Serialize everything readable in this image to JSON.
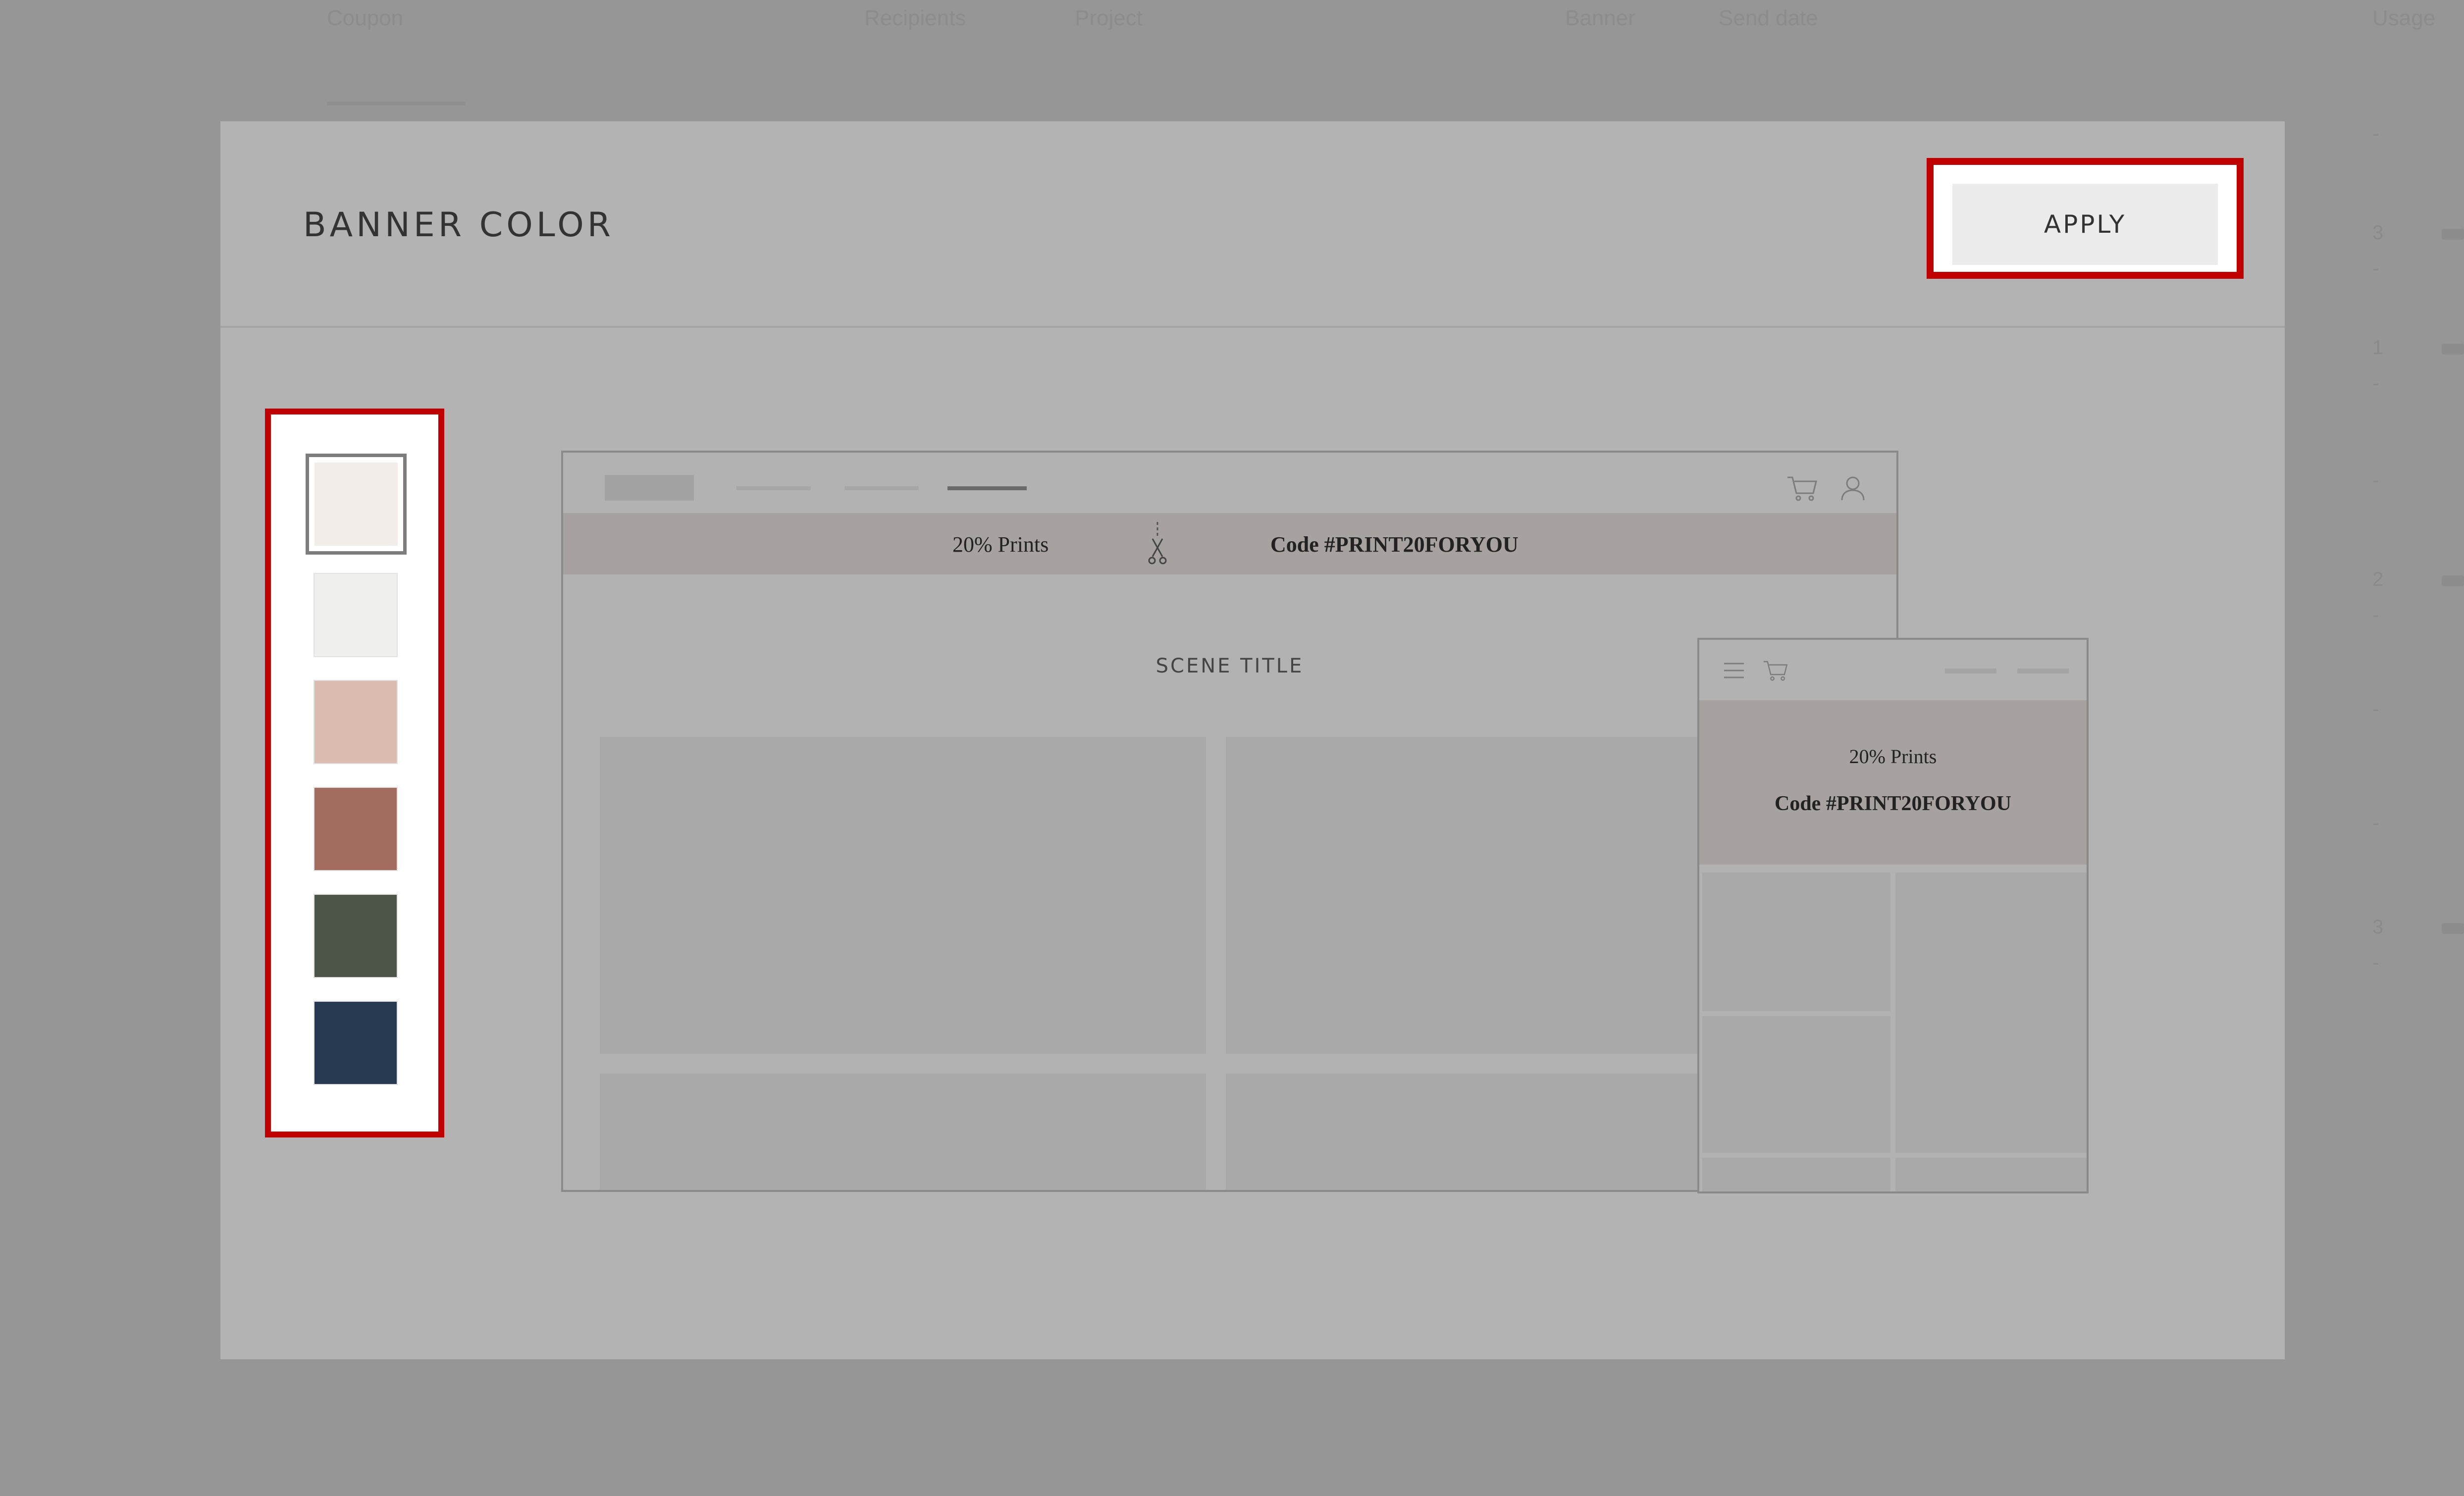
{
  "background": {
    "columns": [
      "Coupon",
      "Recipients",
      "Project",
      "Banner",
      "Send date",
      "Usage"
    ],
    "usage_values": [
      "-",
      "3",
      "-",
      "1",
      "-",
      "-",
      "2",
      "-",
      "-",
      "-",
      "3",
      "-"
    ]
  },
  "modal": {
    "title": "BANNER COLOR",
    "apply_label": "APPLY"
  },
  "swatches": [
    {
      "name": "cream",
      "color": "#f2ede9",
      "selected": true
    },
    {
      "name": "light-gray",
      "color": "#efefed",
      "selected": false
    },
    {
      "name": "blush",
      "color": "#dcbbb1",
      "selected": false
    },
    {
      "name": "terracotta",
      "color": "#a16c5d",
      "selected": false
    },
    {
      "name": "forest-green",
      "color": "#4c5548",
      "selected": false
    },
    {
      "name": "navy",
      "color": "#283a52",
      "selected": false
    }
  ],
  "preview": {
    "banner_offer": "20% Prints",
    "banner_code": "Code #PRINT20FORYOU",
    "scene_title": "SCENE TITLE",
    "banner_color": "#a7a29f"
  },
  "icons": {
    "desktop_cart": "cart-icon",
    "desktop_account": "user-icon",
    "scissors": "scissors-icon",
    "mobile_menu": "hamburger-icon",
    "mobile_cart": "cart-icon"
  }
}
